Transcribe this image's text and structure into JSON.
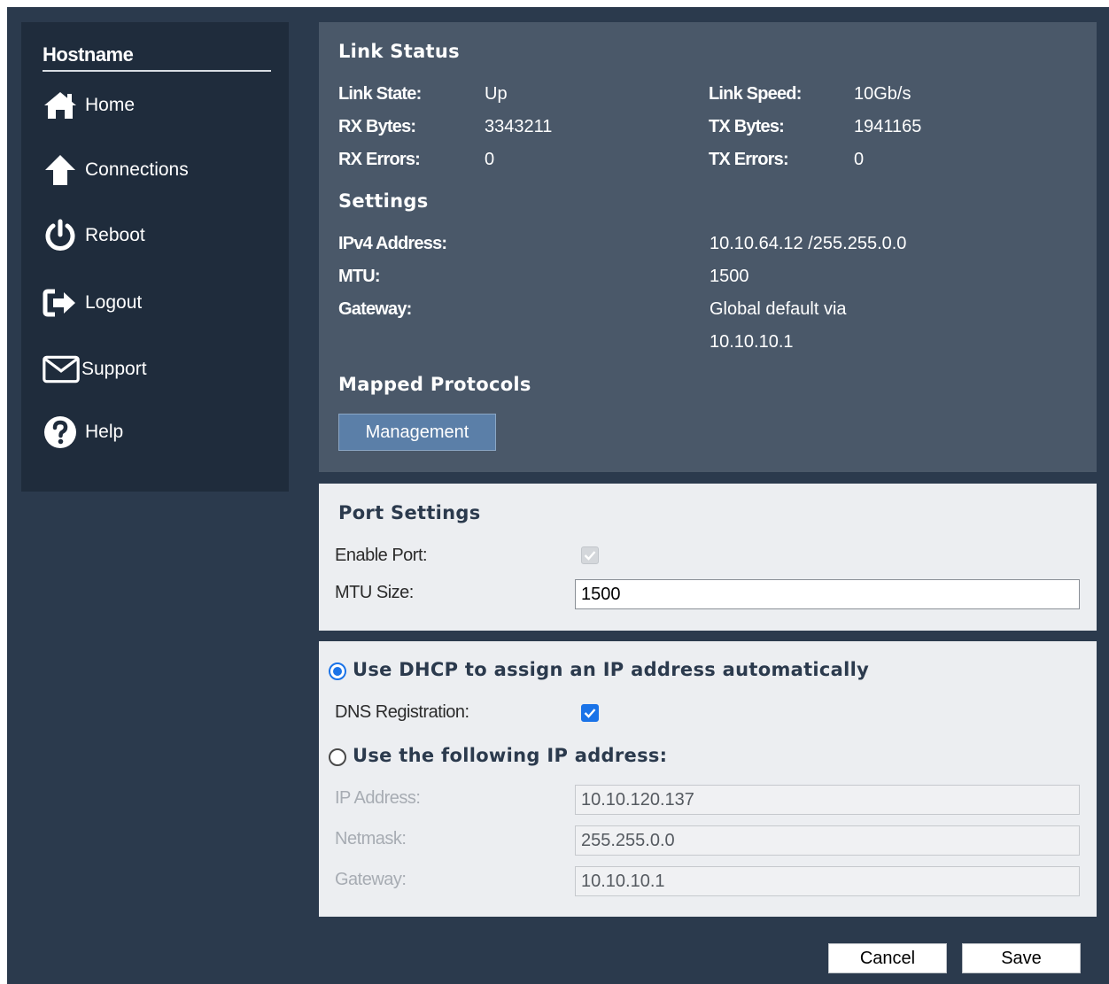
{
  "sidebar": {
    "hostname": "Hostname",
    "items": [
      {
        "label": "Home",
        "icon": "home-icon"
      },
      {
        "label": "Connections",
        "icon": "arrow-up-icon"
      },
      {
        "label": "Reboot",
        "icon": "power-icon"
      },
      {
        "label": "Logout",
        "icon": "logout-icon"
      },
      {
        "label": "Support",
        "icon": "envelope-icon"
      },
      {
        "label": "Help",
        "icon": "question-circle-icon"
      }
    ]
  },
  "link_status": {
    "title": "Link Status",
    "link_state_label": "Link State:",
    "link_state_value": "Up",
    "link_speed_label": "Link Speed:",
    "link_speed_value": "10Gb/s",
    "rx_bytes_label": "RX Bytes:",
    "rx_bytes_value": "3343211",
    "tx_bytes_label": "TX Bytes:",
    "tx_bytes_value": "1941165",
    "rx_errors_label": "RX Errors:",
    "rx_errors_value": "0",
    "tx_errors_label": "TX Errors:",
    "tx_errors_value": "0"
  },
  "settings": {
    "title": "Settings",
    "ipv4_label": "IPv4 Address:",
    "ipv4_value": "10.10.64.12 /255.255.0.0",
    "mtu_label": "MTU:",
    "mtu_value": "1500",
    "gateway_label": "Gateway:",
    "gateway_value_line1": "Global default via",
    "gateway_value_line2": "10.10.10.1"
  },
  "mapped_protocols": {
    "title": "Mapped Protocols",
    "button_label": "Management"
  },
  "port_settings": {
    "title": "Port Settings",
    "enable_port_label": "Enable Port:",
    "enable_port_checked": true,
    "mtu_size_label": "MTU Size:",
    "mtu_size_value": "1500"
  },
  "ip_config": {
    "dhcp_label": "Use DHCP to assign an IP address automatically",
    "dhcp_selected": true,
    "dns_registration_label": "DNS Registration:",
    "dns_registration_checked": true,
    "static_label": "Use the following IP address:",
    "static_selected": false,
    "ip_address_label": "IP Address:",
    "ip_address_value": "10.10.120.137",
    "netmask_label": "Netmask:",
    "netmask_value": "255.255.0.0",
    "gateway_label": "Gateway:",
    "gateway_value": "10.10.10.1"
  },
  "footer": {
    "cancel_label": "Cancel",
    "save_label": "Save"
  },
  "colors": {
    "background": "#2b3a4d",
    "sidebar": "#1f2c3c",
    "status_panel": "#4a5869",
    "form_panel": "#eceef1",
    "accent": "#1a73e8",
    "management_button": "#5b7fa8"
  }
}
